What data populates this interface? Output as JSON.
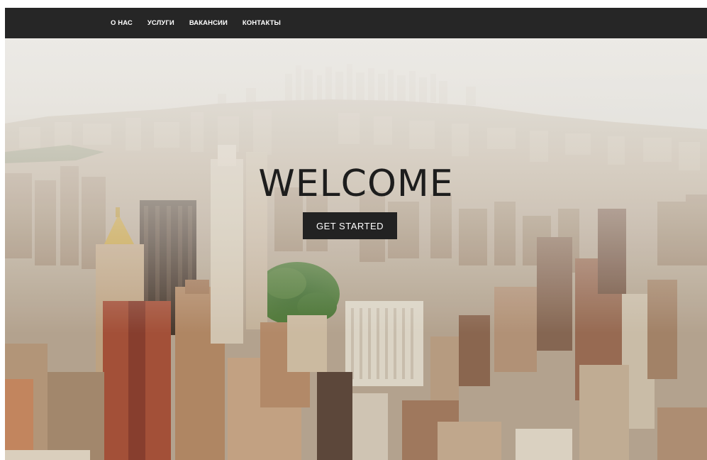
{
  "nav": {
    "items": [
      {
        "label": "О НАС"
      },
      {
        "label": "УСЛУГИ"
      },
      {
        "label": "ВАКАНСИИ"
      },
      {
        "label": "КОНТАКТЫ"
      }
    ]
  },
  "hero": {
    "title": "WELCOME",
    "cta_label": "GET STARTED",
    "image": "aerial-city-skyline-photo"
  },
  "colors": {
    "navbar_bg": "#262626",
    "nav_text": "#ffffff",
    "title_text": "#1d1d1d",
    "button_bg": "#222222",
    "button_text": "#ffffff",
    "sky": "#e9e6df"
  }
}
